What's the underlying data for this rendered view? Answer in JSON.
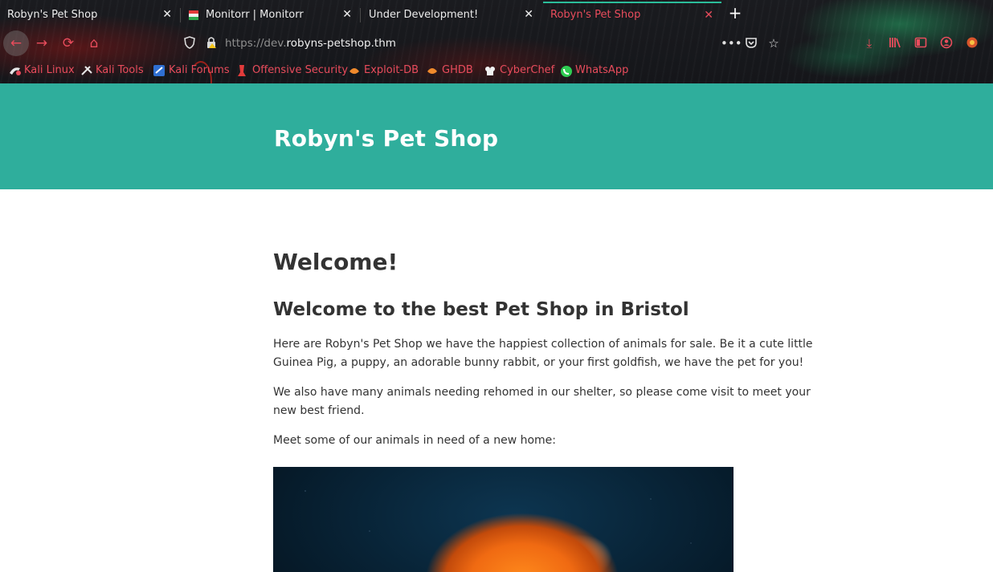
{
  "browser": {
    "tabs": [
      {
        "label": "Robyn's Pet Shop",
        "active": false
      },
      {
        "label": "Monitorr | Monitorr",
        "active": false
      },
      {
        "label": "Under Development!",
        "active": false
      },
      {
        "label": "Robyn's Pet Shop",
        "active": true
      }
    ],
    "url": {
      "prefix": "https://dev.",
      "host": "robyns-petshop.thm"
    },
    "bookmarks": [
      {
        "label": "Kali Linux",
        "icon": "kali-dragon-icon"
      },
      {
        "label": "Kali Tools",
        "icon": "kali-tools-icon"
      },
      {
        "label": "Kali Forums",
        "icon": "kali-forums-icon"
      },
      {
        "label": "Offensive Security",
        "icon": "offsec-icon"
      },
      {
        "label": "Exploit-DB",
        "icon": "exploitdb-icon"
      },
      {
        "label": "GHDB",
        "icon": "ghdb-icon"
      },
      {
        "label": "CyberChef",
        "icon": "cyberchef-icon"
      },
      {
        "label": "WhatsApp",
        "icon": "whatsapp-icon"
      }
    ],
    "accent_color": "#e94c5c",
    "active_tab_line_color": "#2bbd9a"
  },
  "page": {
    "site_title": "Robyn's Pet Shop",
    "header_color": "#2fae9c",
    "heading": "Welcome!",
    "subheading": "Welcome to the best Pet Shop in Bristol",
    "paragraphs": [
      "Here are Robyn's Pet Shop we have the happiest collection of animals for sale. Be it a cute little Guinea Pig, a puppy, an adorable bunny rabbit, or your first goldfish, we have the pet for you!",
      "We also have many animals needing rehomed in our shelter, so please come visit to meet your new best friend.",
      "Meet some of our animals in need of a new home:"
    ]
  }
}
